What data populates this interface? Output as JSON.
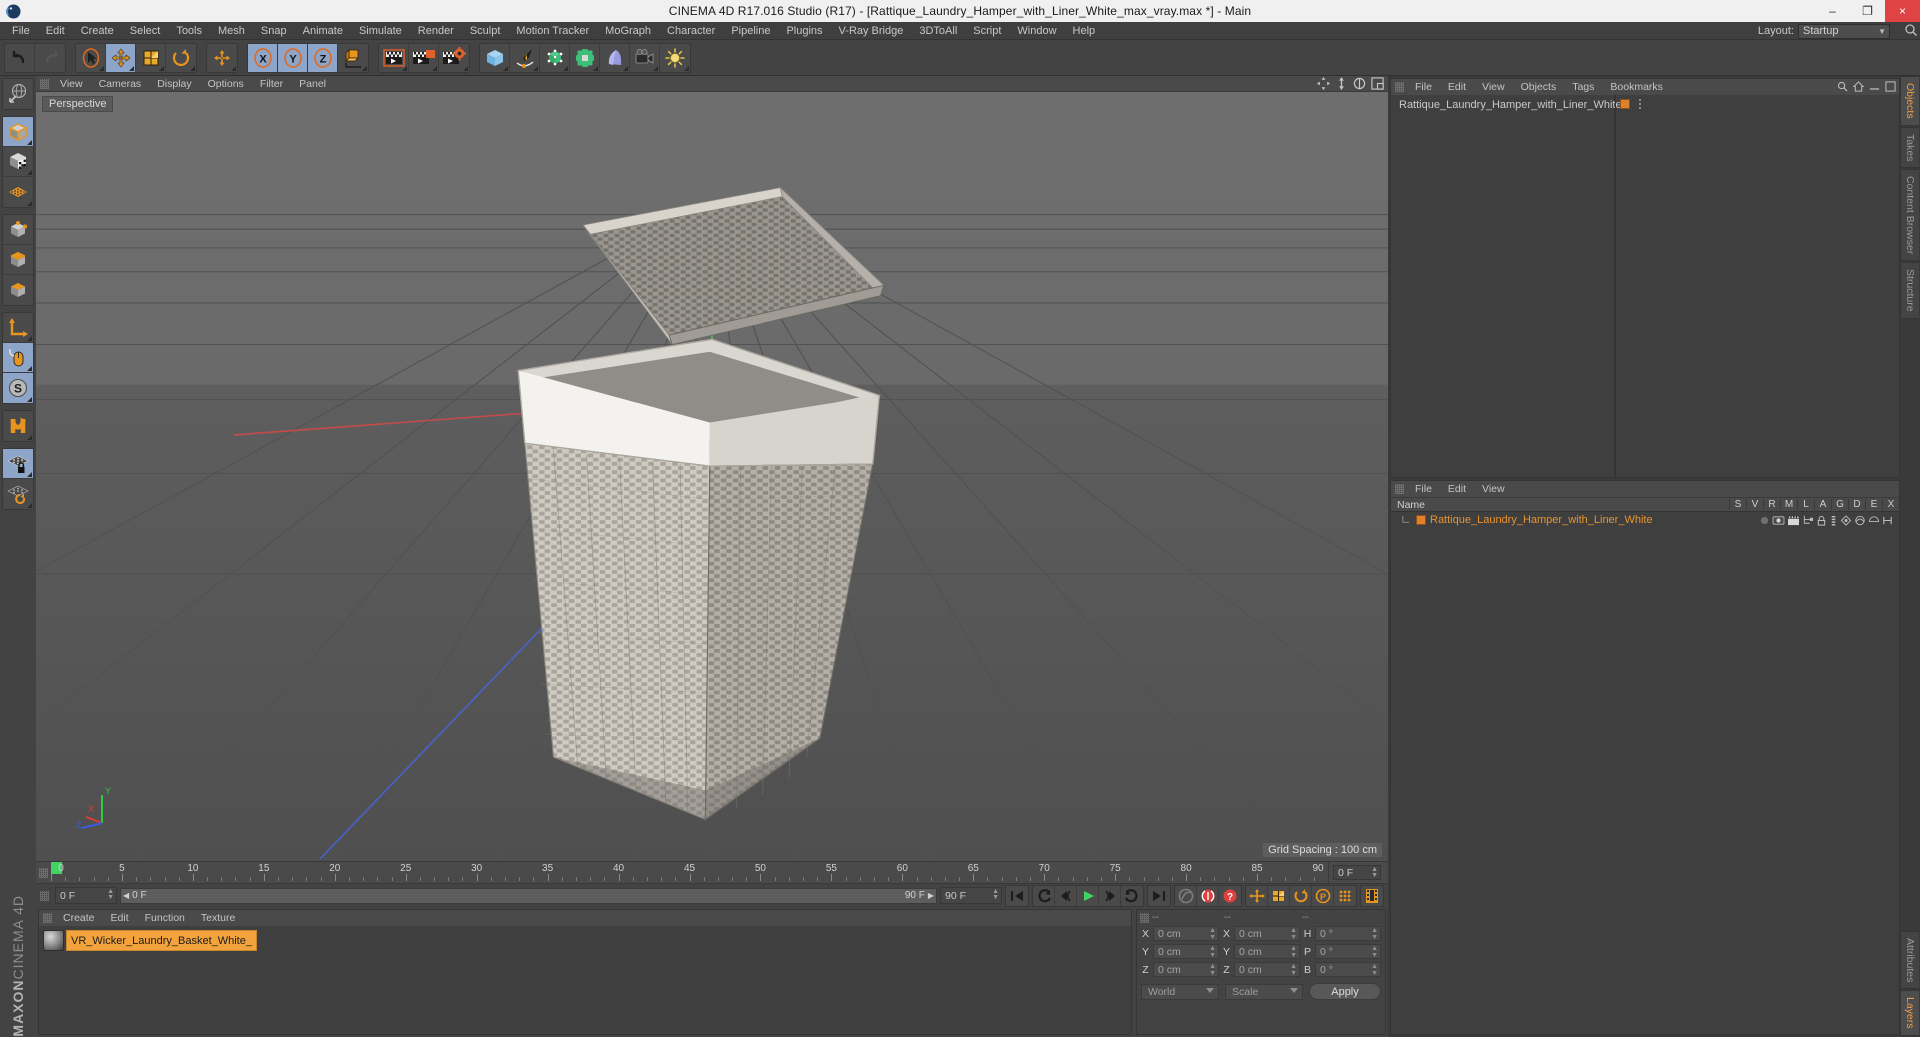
{
  "window": {
    "title": "CINEMA 4D R17.016 Studio (R17) - [Rattique_Laundry_Hamper_with_Liner_White_max_vray.max *] - Main",
    "minimize": "–",
    "maximize": "❐",
    "close": "×"
  },
  "menubar": {
    "items": [
      "File",
      "Edit",
      "Create",
      "Select",
      "Tools",
      "Mesh",
      "Snap",
      "Animate",
      "Simulate",
      "Render",
      "Sculpt",
      "Motion Tracker",
      "MoGraph",
      "Character",
      "Pipeline",
      "Plugins",
      "V-Ray Bridge",
      "3DToAll",
      "Script",
      "Window",
      "Help"
    ],
    "layout_label": "Layout:",
    "layout_value": "Startup"
  },
  "toolbar": {
    "groups": [
      {
        "name": "history",
        "buttons": [
          {
            "name": "undo-button",
            "icon": "undo",
            "active": false
          },
          {
            "name": "redo-button",
            "icon": "redo",
            "active": false
          }
        ]
      },
      {
        "name": "transform-tools",
        "buttons": [
          {
            "name": "select-tool-button",
            "icon": "cursor",
            "active": false
          },
          {
            "name": "move-tool-button",
            "icon": "move",
            "active": true
          },
          {
            "name": "scale-tool-button",
            "icon": "scale",
            "active": false
          },
          {
            "name": "rotate-tool-button",
            "icon": "rotate",
            "active": false
          }
        ]
      },
      {
        "name": "move-group",
        "buttons": [
          {
            "name": "move-duplicate-button",
            "icon": "move2",
            "active": false
          }
        ]
      },
      {
        "name": "axis-locks",
        "buttons": [
          {
            "name": "lock-x-button",
            "icon": "x",
            "active": true
          },
          {
            "name": "lock-y-button",
            "icon": "y",
            "active": true
          },
          {
            "name": "lock-z-button",
            "icon": "z",
            "active": true
          },
          {
            "name": "world-object-axis-button",
            "icon": "worldaxis",
            "active": false
          }
        ]
      },
      {
        "name": "render-tools",
        "buttons": [
          {
            "name": "render-view-button",
            "icon": "render-view",
            "active": false
          },
          {
            "name": "render-to-picture-viewer-button",
            "icon": "render-pv",
            "active": false
          },
          {
            "name": "render-settings-button",
            "icon": "render-settings",
            "active": false
          }
        ]
      },
      {
        "name": "create-tools",
        "buttons": [
          {
            "name": "add-cube-button",
            "icon": "cube-blue",
            "active": false
          },
          {
            "name": "add-spline-button",
            "icon": "pen",
            "active": false
          },
          {
            "name": "add-generator-button",
            "icon": "generator",
            "active": false
          },
          {
            "name": "add-deformer-button",
            "icon": "deformer",
            "active": false
          },
          {
            "name": "add-environment-button",
            "icon": "environment",
            "active": false
          },
          {
            "name": "add-camera-button",
            "icon": "camera",
            "active": false
          },
          {
            "name": "add-light-button",
            "icon": "light",
            "active": false
          }
        ]
      }
    ]
  },
  "left_toolbar": {
    "groups": [
      [
        {
          "name": "undo-view-button",
          "icon": "globe",
          "active": false
        }
      ],
      [
        {
          "name": "make-editable-button",
          "icon": "cube-orange",
          "active": true
        },
        {
          "name": "texture-axis-button",
          "icon": "cube-checker",
          "active": false
        },
        {
          "name": "enable-axis-button",
          "icon": "grid-orange",
          "active": false
        }
      ],
      [
        {
          "name": "point-mode-button",
          "icon": "point-mode",
          "active": false
        },
        {
          "name": "edge-mode-button",
          "icon": "edge-mode",
          "active": false
        },
        {
          "name": "polygon-mode-button",
          "icon": "poly-mode",
          "active": false
        }
      ],
      [
        {
          "name": "object-axis-button",
          "icon": "axis",
          "active": false
        },
        {
          "name": "viewport-solo-button",
          "icon": "mouse",
          "active": true
        },
        {
          "name": "soft-selection-button",
          "icon": "s-circle",
          "active": true
        }
      ],
      [
        {
          "name": "magnet-tool-button",
          "icon": "magnet",
          "active": false
        }
      ],
      [
        {
          "name": "lock-workplane-button",
          "icon": "plane-lock",
          "active": true
        },
        {
          "name": "workplane-toggle-button",
          "icon": "plane-rotate",
          "active": false
        }
      ]
    ],
    "brand_top": "MAXON",
    "brand_bottom": "CINEMA 4D"
  },
  "viewport": {
    "menu": [
      "View",
      "Cameras",
      "Display",
      "Options",
      "Filter",
      "Panel"
    ],
    "perspective_label": "Perspective",
    "grid_spacing": "Grid Spacing : 100 cm",
    "axis": {
      "x": "X",
      "y": "Y",
      "z": "Z"
    },
    "panel_icons": [
      "move-view-icon",
      "zoom-view-icon",
      "rotate-view-icon",
      "maximize-view-icon"
    ]
  },
  "timeline": {
    "ticks": [
      "0",
      "5",
      "10",
      "15",
      "20",
      "25",
      "30",
      "35",
      "40",
      "45",
      "50",
      "55",
      "60",
      "65",
      "70",
      "75",
      "80",
      "85",
      "90"
    ],
    "current_frame_right": "0 F"
  },
  "transport": {
    "current_frame": "0 F",
    "track_start": "0 F",
    "track_end": "90 F",
    "end_frame": "90 F",
    "buttons": [
      {
        "name": "go-to-start-button",
        "icon": "skip-start"
      },
      {
        "name": "previous-key-button",
        "icon": "prev-key"
      },
      {
        "name": "step-back-button",
        "icon": "step-back"
      },
      {
        "name": "play-button",
        "icon": "play"
      },
      {
        "name": "step-forward-button",
        "icon": "step-forward"
      },
      {
        "name": "next-key-button",
        "icon": "next-key"
      },
      {
        "name": "go-to-end-button",
        "icon": "skip-end"
      },
      {
        "name": "autokey-button",
        "icon": "autokey"
      },
      {
        "name": "record-active-objects-button",
        "icon": "record-objects"
      },
      {
        "name": "record-button",
        "icon": "record"
      },
      {
        "name": "key-position-button",
        "icon": "key-position"
      },
      {
        "name": "key-scale-button",
        "icon": "key-scale"
      },
      {
        "name": "key-rotation-button",
        "icon": "key-rotation"
      },
      {
        "name": "key-param-button",
        "icon": "key-param"
      },
      {
        "name": "key-point-button",
        "icon": "key-point"
      },
      {
        "name": "timeline-keyframe-button",
        "icon": "film"
      }
    ]
  },
  "material_manager": {
    "menu": [
      "Create",
      "Edit",
      "Function",
      "Texture"
    ],
    "materials": [
      {
        "name": "VR_Wicker_Laundry_Basket_White_",
        "selected": true
      }
    ]
  },
  "coordinates": {
    "headers": [
      "--",
      "--",
      "--"
    ],
    "rows": [
      {
        "label_pos": "X",
        "value_pos": "0 cm",
        "label_size": "X",
        "value_size": "0 cm",
        "label_rot": "H",
        "value_rot": "0 °"
      },
      {
        "label_pos": "Y",
        "value_pos": "0 cm",
        "label_size": "Y",
        "value_size": "0 cm",
        "label_rot": "P",
        "value_rot": "0 °"
      },
      {
        "label_pos": "Z",
        "value_pos": "0 cm",
        "label_size": "Z",
        "value_size": "0 cm",
        "label_rot": "B",
        "value_rot": "0 °"
      }
    ],
    "coord_system": "World",
    "mode": "Scale",
    "apply": "Apply"
  },
  "object_manager": {
    "menu": [
      "File",
      "Edit",
      "View",
      "Objects",
      "Tags",
      "Bookmarks"
    ],
    "rows": [
      {
        "name": "Rattique_Laundry_Hamper_with_Liner_White",
        "level_badge": "0",
        "swatch": "#e0802c"
      }
    ]
  },
  "attributes_panel": {
    "menu": [
      "File",
      "Edit",
      "View"
    ],
    "name_header": "Name",
    "columns": [
      "S",
      "V",
      "R",
      "M",
      "L",
      "A",
      "G",
      "D",
      "E",
      "X"
    ],
    "rows": [
      {
        "name": "Rattique_Laundry_Hamper_with_Liner_White",
        "color": "#e8932f"
      }
    ]
  },
  "right_tabs": {
    "top": [
      "Objects",
      "Takes",
      "Content Browser",
      "Structure"
    ],
    "top_active": "Objects",
    "bottom": [
      "Attributes",
      "Layers"
    ],
    "bottom_active": "Layers"
  },
  "colors": {
    "accent_orange": "#e8932f",
    "active_blue": "#8ca5c8",
    "panel_bg": "#434343",
    "viewport_bg": "#5f5f5f"
  }
}
